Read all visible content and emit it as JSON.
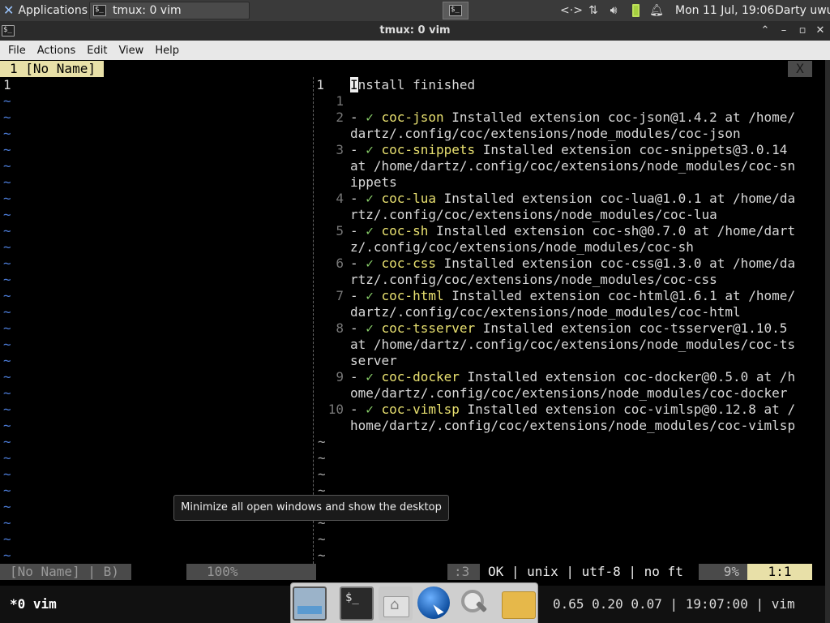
{
  "panel": {
    "applications_label": "Applications",
    "task_label": "tmux: 0 vim",
    "clock": "Mon 11 Jul, 19:06",
    "user": "Darty uwu",
    "tray_icons": [
      "network-transfer-icon",
      "network-updown-icon",
      "volume-icon",
      "battery-icon",
      "notification-bell-icon"
    ]
  },
  "window": {
    "title": "tmux: 0 vim",
    "menus": [
      "File",
      "Actions",
      "Edit",
      "View",
      "Help"
    ]
  },
  "vim": {
    "tab_label": "1 [No Name]",
    "close_label": "X",
    "left_first_line": "1",
    "tilde": "~",
    "right_lines": [
      {
        "num": "1",
        "cur": "I",
        "text": "nstall finished"
      },
      {
        "num": "1",
        "text": ""
      },
      {
        "num": "2",
        "ext": "coc-json",
        "rest": " Installed extension coc-json@1.4.2 at /home/",
        "wrap": "dartz/.config/coc/extensions/node_modules/coc-json"
      },
      {
        "num": "3",
        "ext": "coc-snippets",
        "rest": " Installed extension coc-snippets@3.0.14",
        "wrap": "at /home/dartz/.config/coc/extensions/node_modules/coc-sn",
        "wrap2": "ippets"
      },
      {
        "num": "4",
        "ext": "coc-lua",
        "rest": " Installed extension coc-lua@1.0.1 at /home/da",
        "wrap": "rtz/.config/coc/extensions/node_modules/coc-lua"
      },
      {
        "num": "5",
        "ext": "coc-sh",
        "rest": " Installed extension coc-sh@0.7.0 at /home/dart",
        "wrap": "z/.config/coc/extensions/node_modules/coc-sh"
      },
      {
        "num": "6",
        "ext": "coc-css",
        "rest": " Installed extension coc-css@1.3.0 at /home/da",
        "wrap": "rtz/.config/coc/extensions/node_modules/coc-css"
      },
      {
        "num": "7",
        "ext": "coc-html",
        "rest": " Installed extension coc-html@1.6.1 at /home/",
        "wrap": "dartz/.config/coc/extensions/node_modules/coc-html"
      },
      {
        "num": "8",
        "ext": "coc-tsserver",
        "rest": " Installed extension coc-tsserver@1.10.5",
        "wrap": "at /home/dartz/.config/coc/extensions/node_modules/coc-ts",
        "wrap2": "server"
      },
      {
        "num": "9",
        "ext": "coc-docker",
        "rest": " Installed extension coc-docker@0.5.0 at /h",
        "wrap": "ome/dartz/.config/coc/extensions/node_modules/coc-docker"
      },
      {
        "num": "10",
        "ext": "coc-vimlsp",
        "rest": " Installed extension coc-vimlsp@0.12.8 at /",
        "wrap": "home/dartz/.config/coc/extensions/node_modules/coc-vimlsp"
      }
    ],
    "bullet": "- ",
    "check": "✓ ",
    "status": {
      "left": "[No Name] | B)",
      "mid": "100%",
      "pos": ":3",
      "info": "OK | unix | utf-8 | no ft",
      "pct": "9%",
      "rowcol": "1:1"
    }
  },
  "tooltip": "Minimize all open windows and show the desktop",
  "tmux": {
    "window": "*0 vim",
    "right": "0.65 0.20 0.07 | 19:07:00 | vim"
  },
  "dock": {
    "term_glyph": "$_"
  }
}
